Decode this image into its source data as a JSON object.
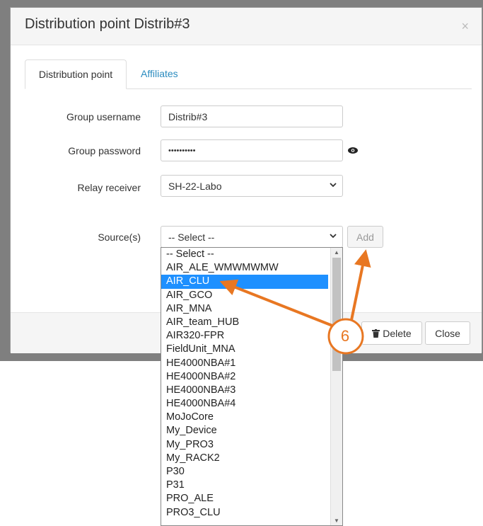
{
  "modal": {
    "title": "Distribution point Distrib#3",
    "close_glyph": "×"
  },
  "tabs": [
    {
      "label": "Distribution point",
      "active": true
    },
    {
      "label": "Affiliates",
      "active": false
    }
  ],
  "form": {
    "group_username": {
      "label": "Group username",
      "value": "Distrib#3"
    },
    "group_password": {
      "label": "Group password",
      "value": "••••••••••"
    },
    "relay_receiver": {
      "label": "Relay receiver",
      "value": "SH-22-Labo"
    },
    "sources": {
      "label": "Source(s)",
      "value": "-- Select --",
      "add_label": "Add"
    }
  },
  "footer": {
    "delete_label": "Delete",
    "close_label": "Close"
  },
  "dropdown": {
    "selected": "AIR_CLU",
    "options": [
      "-- Select --",
      "AIR_ALE_WMWMWMW",
      "AIR_CLU",
      "AIR_GCO",
      "AIR_MNA",
      "AIR_team_HUB",
      "AIR320-FPR",
      "FieldUnit_MNA",
      "HE4000NBA#1",
      "HE4000NBA#2",
      "HE4000NBA#3",
      "HE4000NBA#4",
      "MoJoCore",
      "My_Device",
      "My_PRO3",
      "My_RACK2",
      "P30",
      "P31",
      "PRO_ALE",
      "PRO3_CLU"
    ]
  },
  "annotation": {
    "step": "6",
    "color": "#e87722"
  },
  "icons": {
    "eye": "eye-icon",
    "trash": "trash-icon",
    "chevron": "chevron-down-icon"
  }
}
